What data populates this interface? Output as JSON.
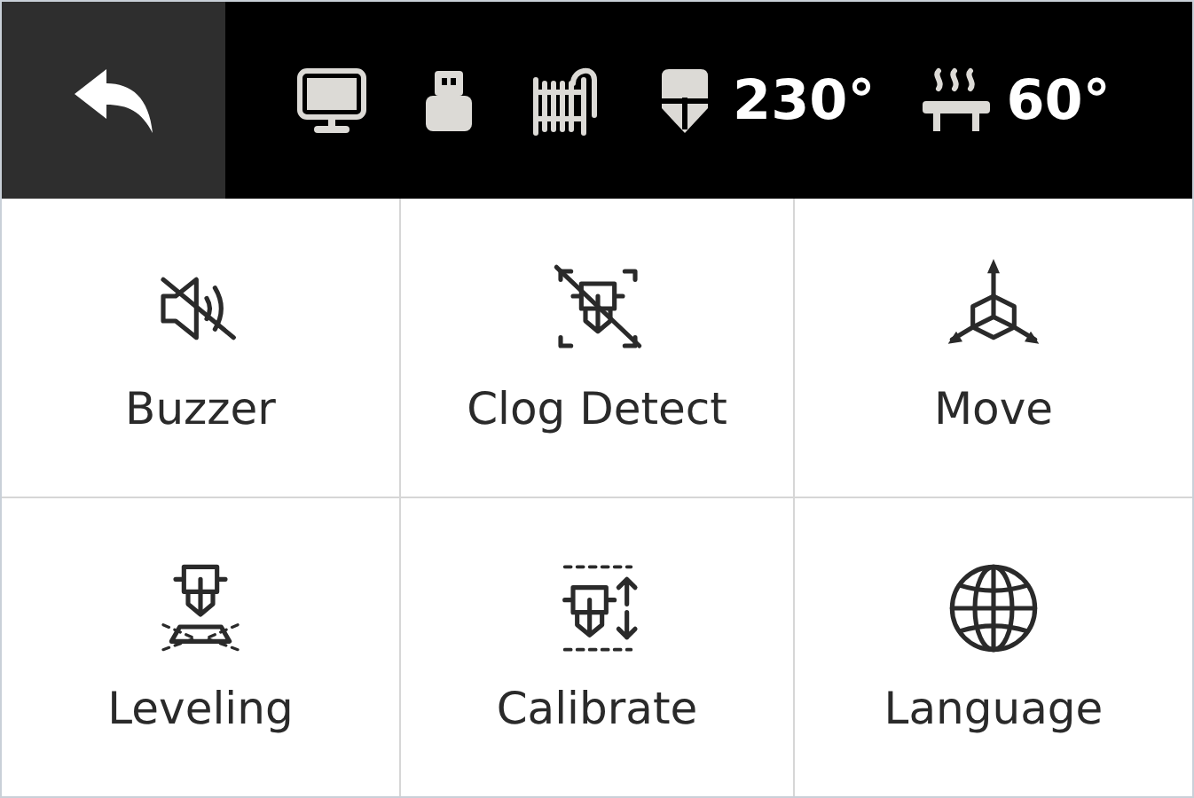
{
  "status_bar": {
    "nozzle_temp": "230°",
    "bed_temp": "60°"
  },
  "tiles": [
    {
      "label": "Buzzer"
    },
    {
      "label": "Clog Detect"
    },
    {
      "label": "Move"
    },
    {
      "label": "Leveling"
    },
    {
      "label": "Calibrate"
    },
    {
      "label": "Language"
    }
  ]
}
